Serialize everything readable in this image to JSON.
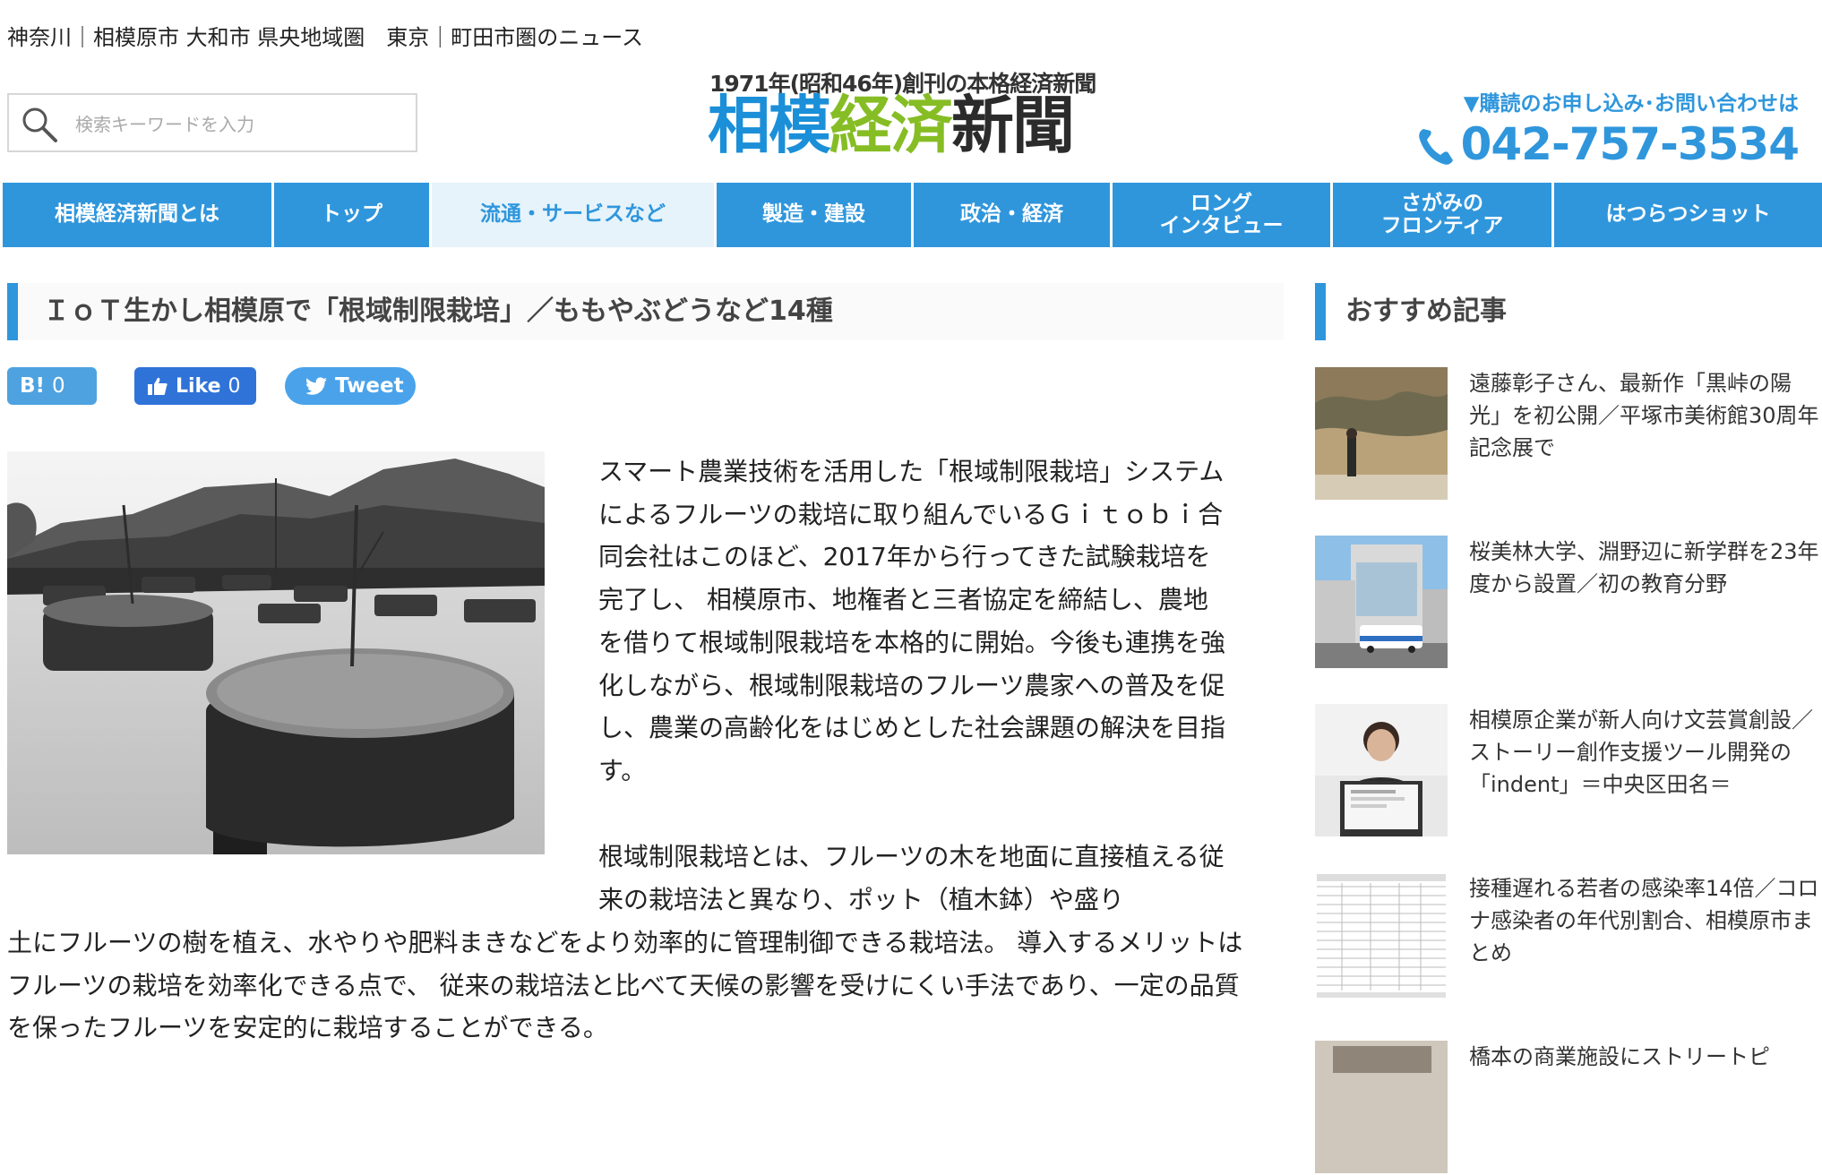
{
  "header": {
    "tagline": "神奈川｜相模原市 大和市 県央地域圏　東京｜町田市圏のニュース",
    "search_placeholder": "検索キーワードを入力",
    "logo_sub": "1971年(昭和46年)創刊の本格経済新聞",
    "logo_part1": "相模",
    "logo_part2": "経済",
    "logo_part3": "新聞",
    "contact_label": "▼購読のお申し込み･お問い合わせは",
    "phone": "042-757-3534"
  },
  "nav": {
    "items": [
      {
        "label": "相模経済新聞とは"
      },
      {
        "label": "トップ"
      },
      {
        "label": "流通・サービスなど"
      },
      {
        "label": "製造・建設"
      },
      {
        "label": "政治・経済"
      },
      {
        "label": "ロング\nインタビュー"
      },
      {
        "label": "さがみの\nフロンティア"
      },
      {
        "label": "はつらつショット"
      }
    ],
    "active_index": 2
  },
  "article": {
    "title": "ＩｏＴ生かし相模原で「根域制限栽培」／ももやぶどうなど14種",
    "share": {
      "hatena_label": "B!",
      "hatena_count": "0",
      "like_label": "Like",
      "like_count": "0",
      "tweet_label": "Tweet"
    },
    "paragraph1": "スマート農業技術を活用した「根域制限栽培」システムによるフルーツの栽培に取り組んでいるＧｉｔｏｂｉ合同会社はこのほど、2017年から行ってきた試験栽培を完了し、 相模原市、地権者と三者協定を締結し、農地を借りて根域制限栽培を本格的に開始。今後も連携を強化しながら、根域制限栽培のフルーツ農家への普及を促し、農業の高齢化をはじめとした社会課題の解決を目指す。",
    "paragraph2_part1": "根域制限栽培とは、フルーツの木を地面に直接植える従来の栽培法と異なり、ポット（植木鉢）や盛り",
    "paragraph2_part2": "土にフルーツの樹を植え、水やりや肥料まきなどをより効率的に管理制御できる栽培法。 導入するメリットはフルーツの栽培を効率化できる点で、 従来の栽培法と比べて天候の影響を受けにくい手法であり、一定の品質を保ったフルーツを安定的に栽培することができる。"
  },
  "sidebar": {
    "heading": "おすすめ記事",
    "items": [
      {
        "title": "遠藤彰子さん、最新作「黒峠の陽光」を初公開／平塚市美術館30周年記念展で"
      },
      {
        "title": "桜美林大学、淵野辺に新学群を23年度から設置／初の教育分野"
      },
      {
        "title": "相模原企業が新人向け文芸賞創設／ストーリー創作支援ツール開発の「indent」＝中央区田名＝"
      },
      {
        "title": "接種遅れる若者の感染率14倍／コロナ感染者の年代別割合、相模原市まとめ"
      },
      {
        "title": "橋本の商業施設にストリートピ"
      }
    ]
  },
  "colors": {
    "accent": "#2f96dc",
    "logo_blue": "#1b8fd8",
    "logo_green": "#86bd24",
    "nav_active_bg": "#e6f3fb"
  },
  "icons": [
    "search-icon",
    "phone-icon",
    "thumbs-up-icon",
    "twitter-bird-icon"
  ]
}
